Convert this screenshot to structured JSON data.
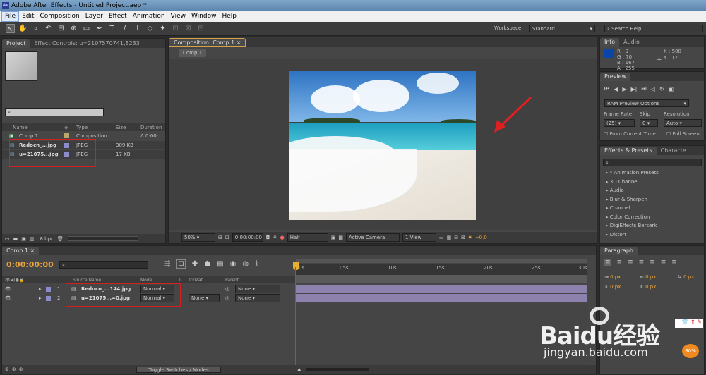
{
  "window": {
    "title": "Adobe After Effects - Untitled Project.aep *",
    "app_icon": "Ae"
  },
  "menu": [
    "File",
    "Edit",
    "Composition",
    "Layer",
    "Effect",
    "Animation",
    "View",
    "Window",
    "Help"
  ],
  "toolbar": {
    "tools": [
      "selection-tool",
      "hand-tool",
      "zoom-tool",
      "rotate-tool",
      "camera-tool",
      "pan-behind-tool",
      "rectangle-tool",
      "pen-tool",
      "type-tool",
      "brush-tool",
      "clone-stamp-tool",
      "eraser-tool",
      "puppet-pin-tool"
    ],
    "workspace_label": "Workspace:",
    "workspace_value": "Standard",
    "search_placeholder": "Search Help"
  },
  "project": {
    "tab_project": "Project",
    "tab_effect_controls": "Effect Controls: u=2107570741,8233",
    "columns": [
      "Name",
      "Type",
      "Size",
      "Duration"
    ],
    "items": [
      {
        "name": "Comp 1",
        "type": "Composition",
        "size": "",
        "duration": "Δ 0:00:"
      },
      {
        "name": "Redocn_...jpg",
        "type": "JPEG",
        "size": "309 KB",
        "duration": ""
      },
      {
        "name": "u=21075...jpg",
        "type": "JPEG",
        "size": "17 KB",
        "duration": ""
      }
    ],
    "bpc": "8 bpc"
  },
  "composition": {
    "tab": "Composition: Comp 1",
    "subtab": "Comp 1",
    "zoom": "50%",
    "timecode": "0:00:00:00",
    "resolution": "Half",
    "camera": "Active Camera",
    "view": "1 View",
    "exposure": "+0.0",
    "image_colors": {
      "sky": "#4f8fd0",
      "sea": "#37b6c8",
      "sand": "#ede8e0"
    }
  },
  "info": {
    "tab_info": "Info",
    "tab_audio": "Audio",
    "r": "R : 9",
    "g": "G : 70",
    "b": "B : 167",
    "a": "A : 255",
    "x": "X : 508",
    "y": "Y : 12",
    "swatch": "#0946a7"
  },
  "preview": {
    "tab": "Preview",
    "options": "RAM Preview Options",
    "frame_rate_label": "Frame Rate",
    "skip_label": "Skip",
    "resolution_label": "Resolution",
    "frame_rate_value": "(25)",
    "skip_value": "0",
    "resolution_value": "Auto",
    "from_current": "From Current Time",
    "full_screen": "Full Screen"
  },
  "effects": {
    "tab": "Effects & Presets",
    "tab2": "Characte",
    "items": [
      "* Animation Presets",
      "3D Channel",
      "Audio",
      "Blur & Sharpen",
      "Channel",
      "Color Correction",
      "DigiEffects Berserk",
      "Distort"
    ]
  },
  "timeline": {
    "tab": "Comp 1",
    "timecode": "0:00:00:00",
    "columns": {
      "source": "Source Name",
      "mode": "Mode",
      "t": "T",
      "trkmat": "TrkMat",
      "parent": "Parent"
    },
    "ruler": [
      "0s",
      "05s",
      "10s",
      "15s",
      "20s",
      "25s",
      "30s"
    ],
    "layers": [
      {
        "num": "1",
        "name": "Redocn_...144.jpg",
        "mode": "Normal",
        "trkmat": "",
        "parent": "None"
      },
      {
        "num": "2",
        "name": "u=21075...=0.jpg",
        "mode": "Normal",
        "trkmat": "None",
        "parent": "None"
      }
    ],
    "toggle": "Toggle Switches / Modes"
  },
  "paragraph": {
    "tab": "Paragraph",
    "indent_values": [
      "0 px",
      "0 px",
      "0 px",
      "0 px",
      "0 px"
    ]
  },
  "watermark": {
    "brand": "Baidu经验",
    "url": "jingyan.baidu.com",
    "badge": "80%"
  }
}
